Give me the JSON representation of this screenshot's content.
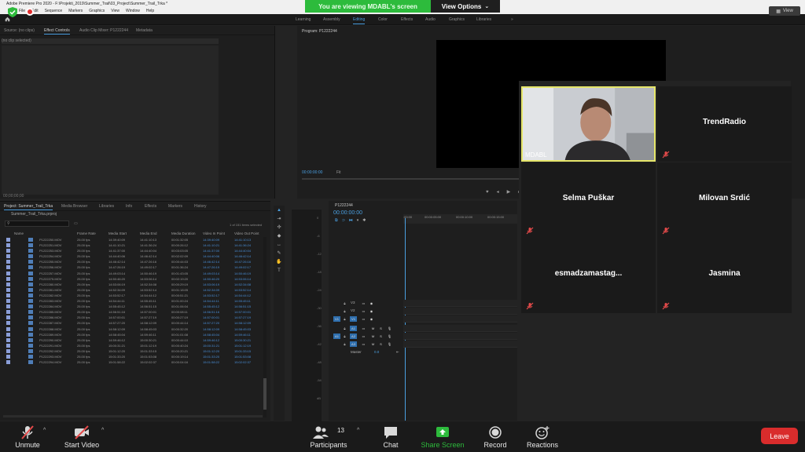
{
  "premiere": {
    "title": "Adobe Premiere Pro 2020 - F:\\Projekti_2019\\Summer_Trail\\03_Project\\Summer_Trail_Trka *",
    "menu": [
      "File",
      "Edit",
      "Sequence",
      "Markers",
      "Graphics",
      "View",
      "Window",
      "Help"
    ],
    "workspaces": [
      "Learning",
      "Assembly",
      "Editing",
      "Color",
      "Effects",
      "Audio",
      "Graphics",
      "Libraries"
    ],
    "workspace_more": "»",
    "source_tabs": [
      "Source: (no clips)",
      "Effect Controls",
      "Audio Clip Mixer: P1222244",
      "Metadata"
    ],
    "effect_controls_clip": "(no clip selected)",
    "source_timecode": "00;00;00;00",
    "program_tab": "Program: P1222244",
    "program_timecode": "00:00:00:00",
    "program_fit": "Fit",
    "project": {
      "tabs": [
        "Project: Summer_Trail_Trka",
        "Media Browser",
        "Libraries",
        "Info",
        "Effects",
        "Markers",
        "History"
      ],
      "bin_path": "Summer_Trail_Trka.prproj",
      "items_selected": "1 of 151 items selected",
      "columns": [
        "Name",
        "Frame Rate",
        "Media Start",
        "Media End",
        "Media Duration",
        "Video In Point",
        "Video Out Point"
      ],
      "rows": [
        [
          "P1222250.MOV",
          "25.00 fps",
          "14:39:40:09",
          "14:41:10:13",
          "00:01:32:05",
          "14:39:40:09",
          "14:41:10:13"
        ],
        [
          "P1222251.MOV",
          "25.00 fps",
          "14:41:10:21",
          "14:41:36:24",
          "00:00:26:12",
          "14:41:10:21",
          "14:41:36:24"
        ],
        [
          "P1222253.MOV",
          "25.00 fps",
          "14:41:37:00",
          "14:44:40:04",
          "00:03:03:05",
          "14:41:37:00",
          "14:44:40:04"
        ],
        [
          "P1222254.MOV",
          "25.00 fps",
          "14:44:40:06",
          "14:46:42:14",
          "00:02:02:09",
          "14:44:40:06",
          "14:46:42:14"
        ],
        [
          "P1222255.MOV",
          "25.00 fps",
          "14:46:42:14",
          "14:47:26:16",
          "00:00:44:03",
          "14:46:42:14",
          "14:47:26:16"
        ],
        [
          "P1222256.MOV",
          "25.00 fps",
          "14:47:26:19",
          "14:49:02:17",
          "00:01:36:24",
          "14:47:26:19",
          "14:49:02:17"
        ],
        [
          "P1222257.MOV",
          "25.00 fps",
          "14:49:03:14",
          "14:50:46:19",
          "00:01:43:05",
          "14:49:03:14",
          "14:50:46:19"
        ],
        [
          "P1222275.MOV",
          "25.00 fps",
          "14:50:46:20",
          "14:53:06:14",
          "00:02:19:20",
          "14:50:46:20",
          "14:53:06:14"
        ],
        [
          "P1222280.MOV",
          "25.00 fps",
          "14:53:06:19",
          "14:52:34:08",
          "00:00:29:19",
          "14:53:06:19",
          "14:52:34:08"
        ],
        [
          "P1222281.MOV",
          "25.00 fps",
          "14:52:34:09",
          "14:53:52:14",
          "00:01:18:05",
          "14:52:34:09",
          "14:53:52:14"
        ],
        [
          "P1222282.MOV",
          "25.00 fps",
          "14:53:52:17",
          "14:54:44:12",
          "00:00:51:21",
          "14:53:52:17",
          "14:54:44:12"
        ],
        [
          "P1222283.MOV",
          "25.00 fps",
          "14:54:44:11",
          "14:55:45:11",
          "00:01:00:24",
          "14:54:44:11",
          "14:55:45:11"
        ],
        [
          "P1222284.MOV",
          "25.00 fps",
          "14:55:45:12",
          "14:56:51:15",
          "00:01:06:04",
          "14:55:45:12",
          "14:56:51:15"
        ],
        [
          "P1222285.MOV",
          "25.00 fps",
          "14:56:51:16",
          "14:57:00:01",
          "00:00:08:11",
          "14:56:51:16",
          "14:57:00:01"
        ],
        [
          "P1222286.MOV",
          "25.00 fps",
          "14:57:00:01",
          "14:57:27:19",
          "00:00:27:19",
          "14:57:00:01",
          "14:57:27:19"
        ],
        [
          "P1222287.MOV",
          "25.00 fps",
          "14:57:27:20",
          "14:58:12:09",
          "00:00:44:14",
          "14:57:27:20",
          "14:58:12:09"
        ],
        [
          "P1222288.MOV",
          "25.00 fps",
          "14:58:12:09",
          "14:58:45:03",
          "00:00:32:20",
          "14:58:12:09",
          "14:58:45:03"
        ],
        [
          "P1222289.MOV",
          "25.00 fps",
          "14:58:45:04",
          "14:59:46:11",
          "00:01:01:08",
          "14:58:45:04",
          "14:59:46:11"
        ],
        [
          "P1222290.MOV",
          "25.00 fps",
          "14:59:46:12",
          "15:00:30:21",
          "00:00:44:10",
          "14:59:46:12",
          "15:00:30:21"
        ],
        [
          "P1222291.MOV",
          "25.00 fps",
          "15:00:31:21",
          "15:01:12:19",
          "00:00:40:24",
          "15:00:31:21",
          "15:01:12:19"
        ],
        [
          "P1222292.MOV",
          "25.00 fps",
          "15:01:12:20",
          "15:01:33:15",
          "00:00:20:21",
          "15:01:12:20",
          "15:01:33:15"
        ],
        [
          "P1222293.MOV",
          "25.00 fps",
          "15:01:33:20",
          "15:01:53:08",
          "00:00:19:14",
          "15:01:33:20",
          "15:01:53:08"
        ],
        [
          "P1222294.MOV",
          "25.00 fps",
          "15:01:58:22",
          "15:02:02:37",
          "00:00:04:16",
          "15:01:58:22",
          "15:02:02:37"
        ]
      ]
    },
    "timeline": {
      "tab": "P1222244",
      "timecode": "00:00:00:00",
      "ruler": [
        ":00:00",
        "00:00:05:00",
        "00:00:10:00",
        "00:00:15:00"
      ],
      "video_tracks": [
        "V3",
        "V2",
        "V1"
      ],
      "audio_tracks": [
        "A1",
        "A2",
        "A3"
      ],
      "master": "Master",
      "master_value": "0.0"
    },
    "meter_ticks": [
      "0",
      "-6",
      "-12",
      "-18",
      "-24",
      "-30",
      "-36",
      "-42",
      "-48",
      "-54",
      "dB"
    ]
  },
  "zoom": {
    "banner_text": "You are viewing MDABL's screen",
    "view_options": "View Options",
    "view_button": "View",
    "participants_tiles": [
      {
        "name": "MDABL",
        "video": true
      },
      {
        "name": "TrendRadio",
        "video": false
      },
      {
        "name": "Selma Puškar",
        "video": false
      },
      {
        "name": "Milovan Srdić",
        "video": false
      },
      {
        "name": "esmadzamastag...",
        "video": false
      },
      {
        "name": "Jasmina",
        "video": false
      }
    ],
    "toolbar": {
      "unmute": "Unmute",
      "start_video": "Start Video",
      "participants": "Participants",
      "participants_count": "13",
      "chat": "Chat",
      "share_screen": "Share Screen",
      "record": "Record",
      "reactions": "Reactions",
      "leave": "Leave"
    },
    "colors": {
      "banner": "#2dbb3c",
      "share": "#2dbb3c",
      "leave": "#d92c2c",
      "active_speaker": "#e6e66a"
    }
  }
}
